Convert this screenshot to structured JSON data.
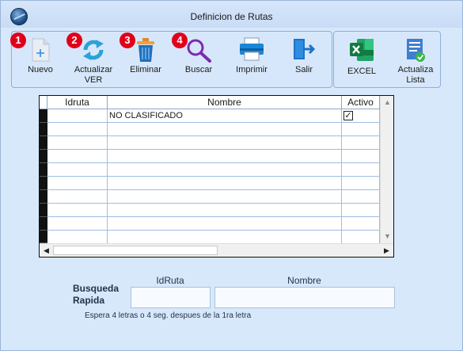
{
  "window": {
    "title": "Definicion de Rutas"
  },
  "toolbar": {
    "buttons": [
      {
        "label": "Nuevo",
        "badge": "1",
        "icon": "new-document-icon"
      },
      {
        "label": "Actualizar\nVER",
        "badge": "2",
        "icon": "refresh-icon"
      },
      {
        "label": "Eliminar",
        "badge": "3",
        "icon": "trash-icon"
      },
      {
        "label": "Buscar",
        "badge": "4",
        "icon": "magnifier-icon"
      },
      {
        "label": "Imprimir",
        "icon": "printer-icon"
      },
      {
        "label": "Salir",
        "icon": "exit-icon"
      }
    ],
    "secondary": [
      {
        "label": "EXCEL",
        "icon": "excel-icon"
      },
      {
        "label": "Actualiza\nLista",
        "icon": "update-list-icon"
      }
    ]
  },
  "grid": {
    "columns": [
      "Idruta",
      "Nombre",
      "Activo"
    ],
    "rows": [
      {
        "idruta": "",
        "nombre": "NO CLASIFICADO",
        "activo": true
      }
    ]
  },
  "search": {
    "label_line1": "Busqueda",
    "label_line2": "Rapida",
    "idruta_label": "IdRuta",
    "nombre_label": "Nombre",
    "idruta_value": "",
    "nombre_value": "",
    "hint": "Espera 4 letras o 4 seg. despues de la 1ra letra"
  },
  "colors": {
    "accent": "#e1001a",
    "background": "#d8e8fb"
  }
}
